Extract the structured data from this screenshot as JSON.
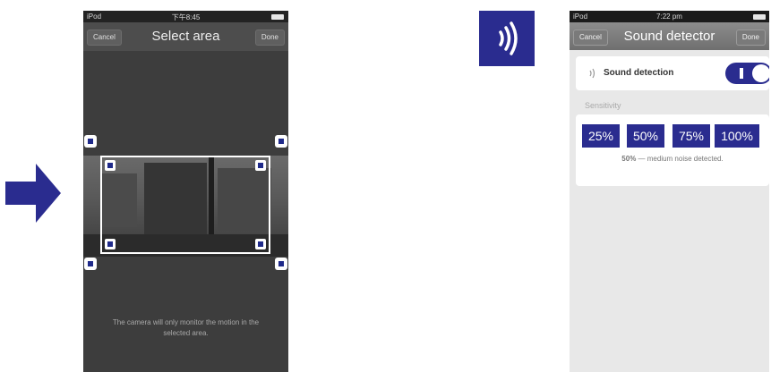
{
  "colors": {
    "accent": "#2a2c8f",
    "white": "#ffffff"
  },
  "arrow": {
    "icon": "right-arrow-icon"
  },
  "select_area": {
    "status": {
      "carrier": "iPod",
      "time": "下午8:45"
    },
    "nav": {
      "cancel": "Cancel",
      "title": "Select area",
      "done": "Done"
    },
    "hint": "The camera will only monitor the motion in the selected area."
  },
  "sound_tile": {
    "icon": "sound-waves-icon"
  },
  "sound_detector": {
    "status": {
      "carrier": "iPod",
      "time": "7:22 pm"
    },
    "nav": {
      "cancel": "Cancel",
      "title": "Sound detector",
      "done": "Done"
    },
    "detection": {
      "label": "Sound detection",
      "enabled": true
    },
    "sensitivity": {
      "label": "Sensitivity",
      "options": [
        "25%",
        "50%",
        "75%",
        "100%"
      ],
      "selected": "50%",
      "desc_value": "50%",
      "desc_text": " — medium noise detected."
    }
  }
}
